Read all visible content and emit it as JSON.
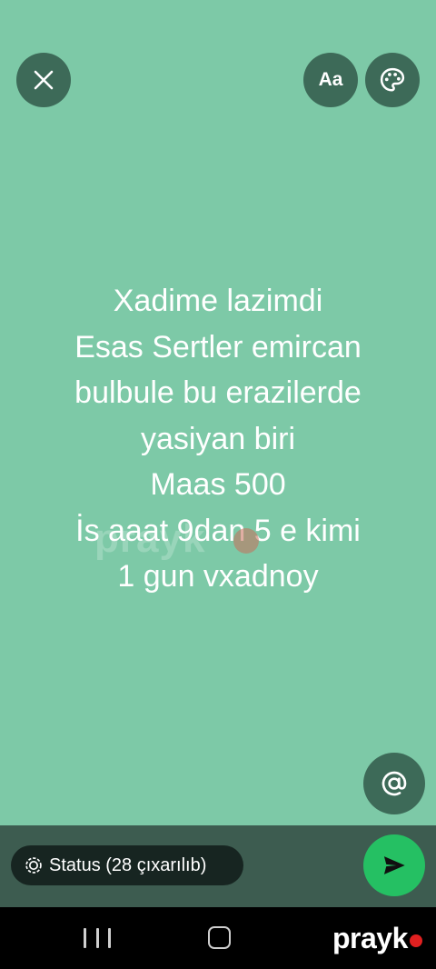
{
  "status_editor": {
    "text_lines": [
      "Xadime lazimdi",
      "Esas Sertler emircan",
      "bulbule bu erazilerde",
      "yasiyan biri",
      "Maas 500",
      "İs aaat 9dan 5 e kimi",
      "1 gun vxadnoy"
    ],
    "background_color": "#7dc9a7",
    "font_button_label": "Aa"
  },
  "icons": {
    "close": "close-icon",
    "palette": "palette-icon",
    "mention": "at-sign-icon",
    "status": "status-icon",
    "send": "send-icon"
  },
  "bottom_bar": {
    "status_label": "Status (28 çıxarılıb)",
    "send_color": "#25c063"
  },
  "nav": {
    "logo_text": "prayk"
  },
  "watermark": {
    "text": "prayk"
  }
}
